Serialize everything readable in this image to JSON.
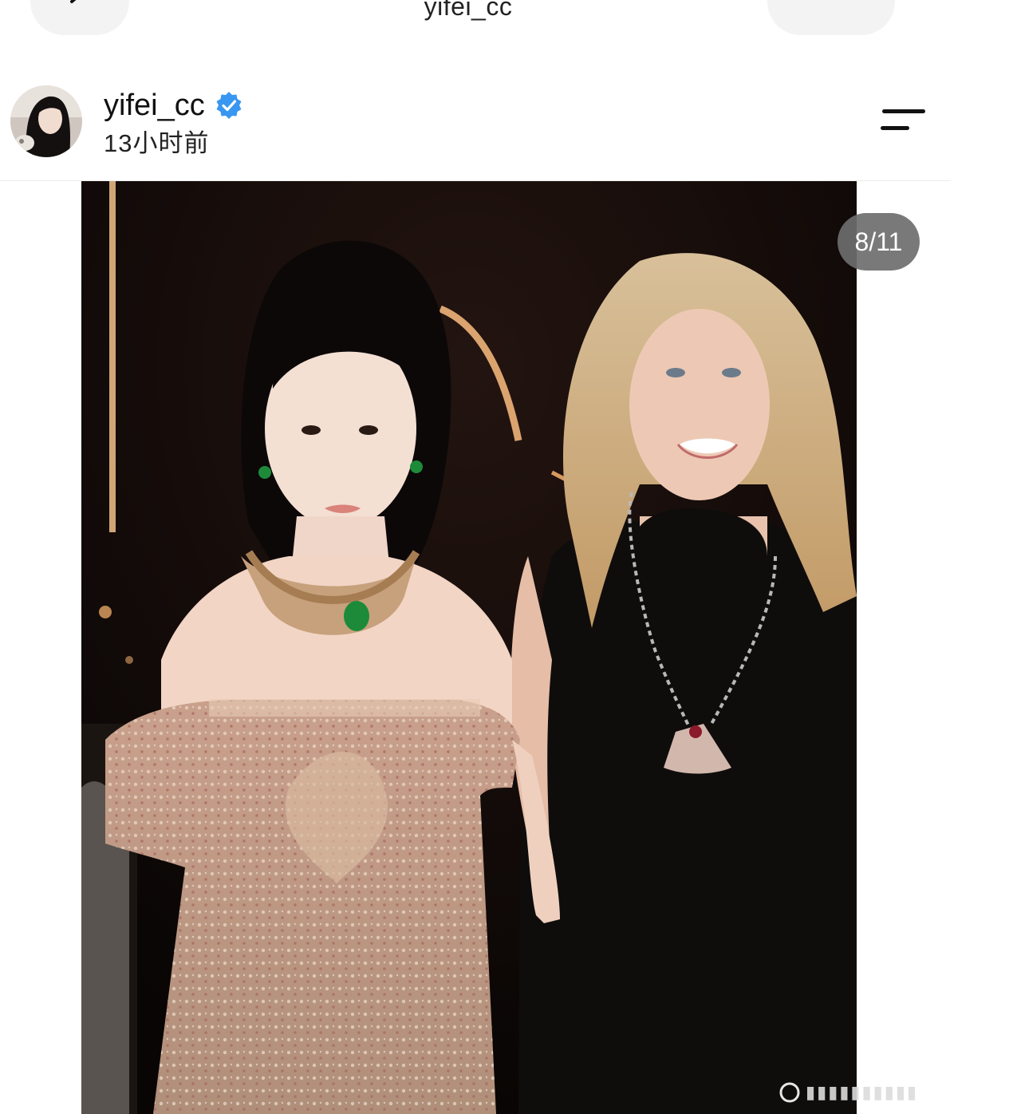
{
  "top_bar": {
    "title": "yifei_cc",
    "back_icon": "chevron-left-icon"
  },
  "post": {
    "username": "yifei_cc",
    "verified_icon": "verified-badge-icon",
    "timestamp": "13小时前",
    "menu_icon": "menu-icon",
    "image": {
      "counter": "8/11",
      "description_icons": [
        "photo-slide"
      ]
    }
  },
  "colors": {
    "verified_blue": "#3897f0",
    "counter_bg": "#6e6e6e",
    "photo_bg": "#0c0807"
  }
}
